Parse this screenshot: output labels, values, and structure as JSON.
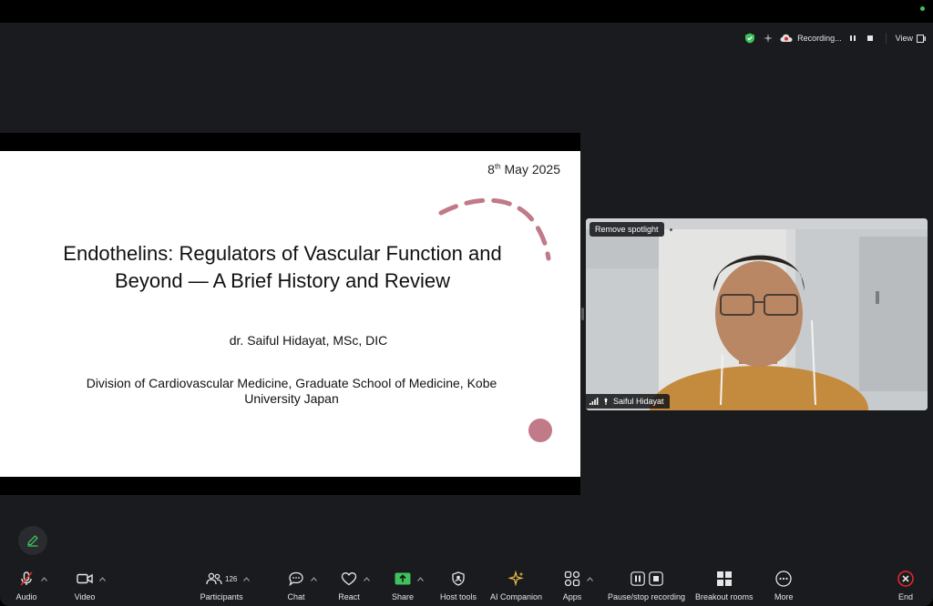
{
  "topbar": {
    "recording_label": "Recording...",
    "view_label": "View"
  },
  "slide": {
    "date_day": "8",
    "date_suffix": "th",
    "date_rest": " May 2025",
    "title_line1": "Endothelins: Regulators of Vascular Function and",
    "title_line2": "Beyond — A Brief History and Review",
    "author": "dr. Saiful Hidayat, MSc, DIC",
    "affiliation_line1": "Division of Cardiovascular Medicine, Graduate School of Medicine, Kobe",
    "affiliation_line2": "University Japan"
  },
  "video": {
    "remove_spotlight_label": "Remove spotlight",
    "participant_name": "Saiful Hidayat"
  },
  "toolbar": {
    "audio": "Audio",
    "video": "Video",
    "participants": "Participants",
    "participants_count": "126",
    "chat": "Chat",
    "react": "React",
    "share": "Share",
    "host_tools": "Host tools",
    "ai_companion": "AI Companion",
    "apps": "Apps",
    "pause_stop_recording": "Pause/stop recording",
    "breakout_rooms": "Breakout rooms",
    "more": "More",
    "end": "End"
  },
  "colors": {
    "share_green": "#3fc25b",
    "end_red": "#e02828",
    "accent_pink": "#c07a88",
    "ai_gold": "#e8b84a"
  }
}
